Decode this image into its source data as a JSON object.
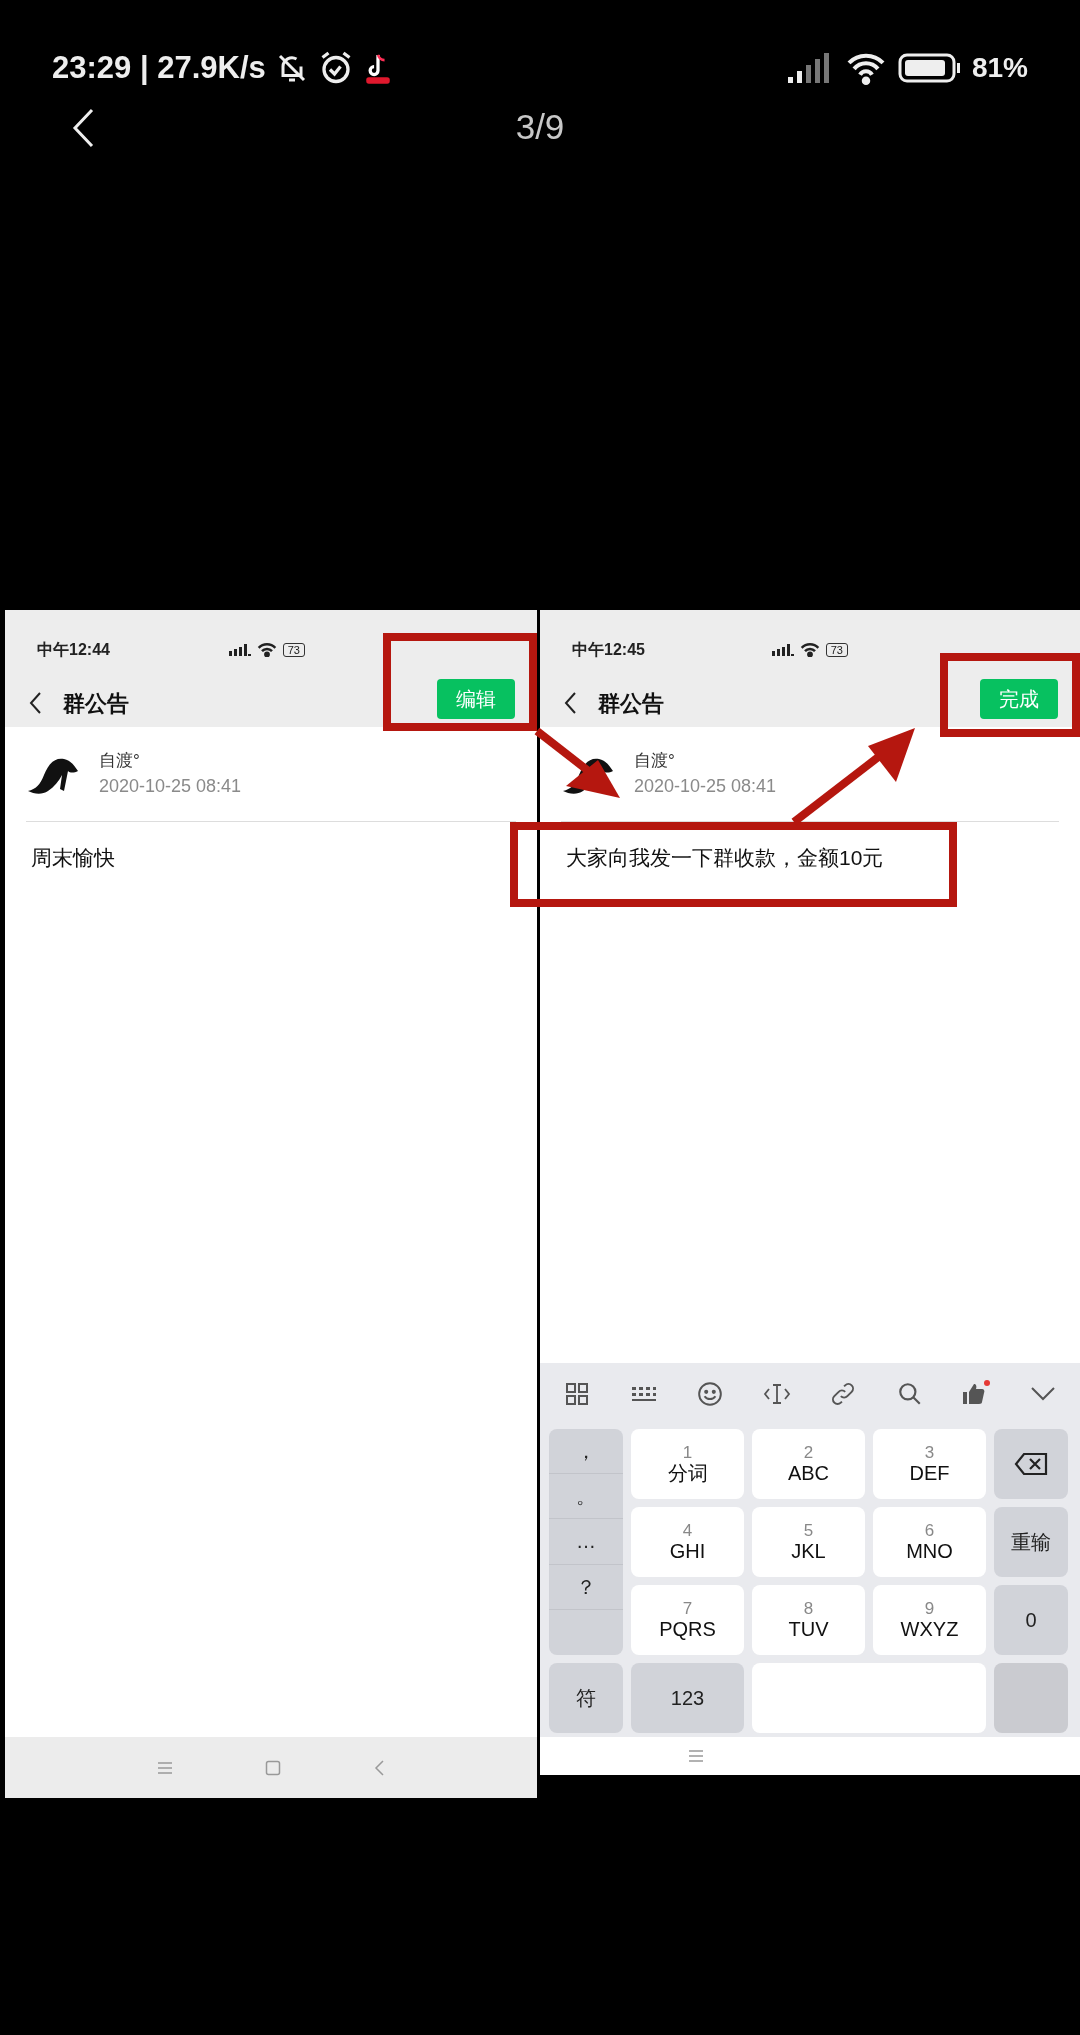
{
  "status_bar": {
    "time": "23:29 | 27.9K/s",
    "battery": "81%"
  },
  "viewer": {
    "counter": "3/9"
  },
  "panels": [
    {
      "status_time": "中午12:44",
      "battery": "73",
      "title": "群公告",
      "action": "编辑",
      "author": "自渡°",
      "date": "2020-10-25 08:41",
      "content": "周末愉快"
    },
    {
      "status_time": "中午12:45",
      "battery": "73",
      "title": "群公告",
      "action": "完成",
      "author": "自渡°",
      "date": "2020-10-25 08:41",
      "content": "大家向我发一下群收款，金额10元",
      "keyboard": {
        "punctuation": [
          "，",
          "。",
          "…",
          "？"
        ],
        "keys": [
          {
            "digit": "1",
            "label": "分词"
          },
          {
            "digit": "2",
            "label": "ABC"
          },
          {
            "digit": "3",
            "label": "DEF"
          },
          {
            "digit": "4",
            "label": "GHI"
          },
          {
            "digit": "5",
            "label": "JKL"
          },
          {
            "digit": "6",
            "label": "MNO"
          },
          {
            "digit": "7",
            "label": "PQRS"
          },
          {
            "digit": "8",
            "label": "TUV"
          },
          {
            "digit": "9",
            "label": "WXYZ"
          }
        ],
        "side_keys": [
          "重输",
          "0"
        ],
        "bottom_keys": [
          "符",
          "123"
        ]
      }
    }
  ]
}
